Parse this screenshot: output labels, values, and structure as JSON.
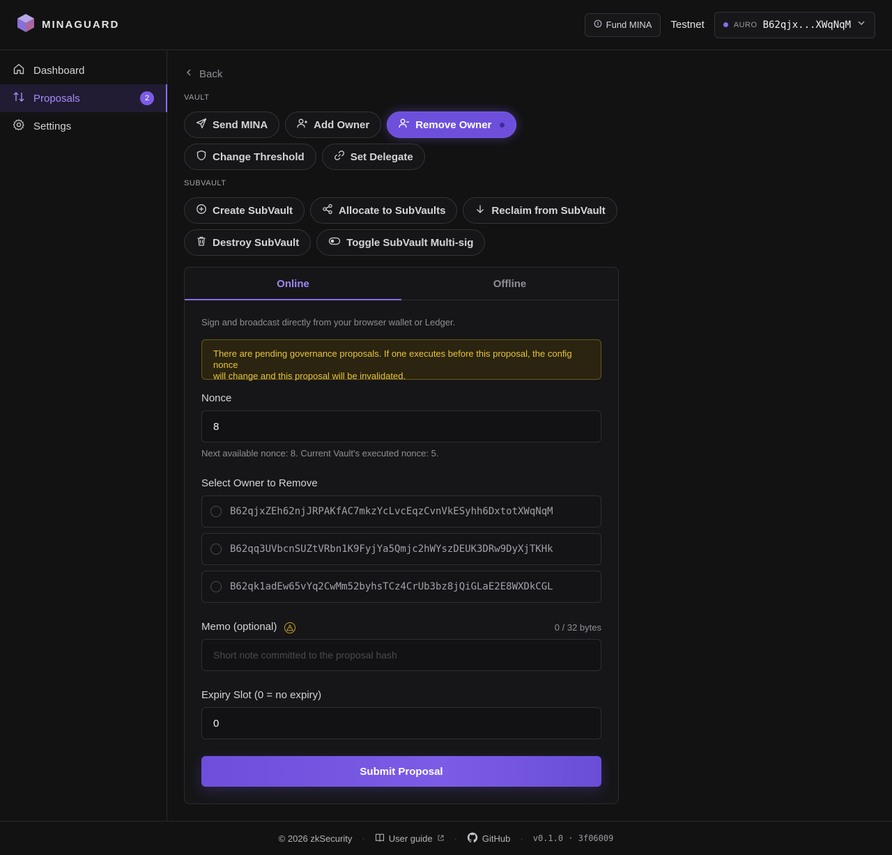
{
  "app": {
    "brand": "MINAGUARD",
    "fund_label": "Fund MINA",
    "network": "Testnet",
    "wallet_tag": "AURO",
    "wallet_address": "B62qjx...XWqNqM"
  },
  "sidebar": {
    "items": [
      {
        "label": "Dashboard",
        "icon": "home-icon"
      },
      {
        "label": "Proposals",
        "icon": "arrows-updown-icon",
        "badge": "2"
      },
      {
        "label": "Settings",
        "icon": "gear-icon"
      }
    ]
  },
  "main": {
    "back_label": "Back",
    "vault_label": "VAULT",
    "vault_actions": [
      "Send MINA",
      "Add Owner",
      "Remove Owner",
      "Change Threshold",
      "Set Delegate"
    ],
    "subvault_label": "SUBVAULT",
    "subvault_actions": [
      "Create SubVault",
      "Allocate to SubVaults",
      "Reclaim from SubVault",
      "Destroy SubVault",
      "Toggle SubVault Multi-sig"
    ]
  },
  "form": {
    "tabs": [
      "Online",
      "Offline"
    ],
    "hint": "Sign and broadcast directly from your browser wallet or Ledger.",
    "warning_line1": "There are pending governance proposals. If one executes before this proposal, the config nonce",
    "warning_line2": "will change and this proposal will be invalidated.",
    "nonce_label": "Nonce",
    "nonce_value": "8",
    "nonce_hint": "Next available nonce: 8. Current Vault's executed nonce: 5.",
    "owner_label": "Select Owner to Remove",
    "owners": [
      "B62qjxZEh62njJRPAKfAC7mkzYcLvcEqzCvnVkESyhh6DxtotXWqNqM",
      "B62qq3UVbcnSUZtVRbn1K9FyjYa5Qmjc2hWYszDEUK3DRw9DyXjTKHk",
      "B62qk1adEw65vYq2CwMm52byhsTCz4CrUb3bz8jQiGLaE2E8WXDkCGL"
    ],
    "memo_label": "Memo (optional)",
    "memo_counter": "0 / 32 bytes",
    "memo_placeholder": "Short note committed to the proposal hash",
    "expiry_label": "Expiry Slot (0 = no expiry)",
    "expiry_value": "0",
    "submit_label": "Submit Proposal"
  },
  "footer": {
    "copyright": "© 2026 zkSecurity",
    "guide": "User guide",
    "github": "GitHub",
    "version": "v0.1.0 · 3f06009"
  },
  "colors": {
    "accent": "#7c5ce6",
    "warning": "#e8c43a",
    "background": "#121212"
  }
}
